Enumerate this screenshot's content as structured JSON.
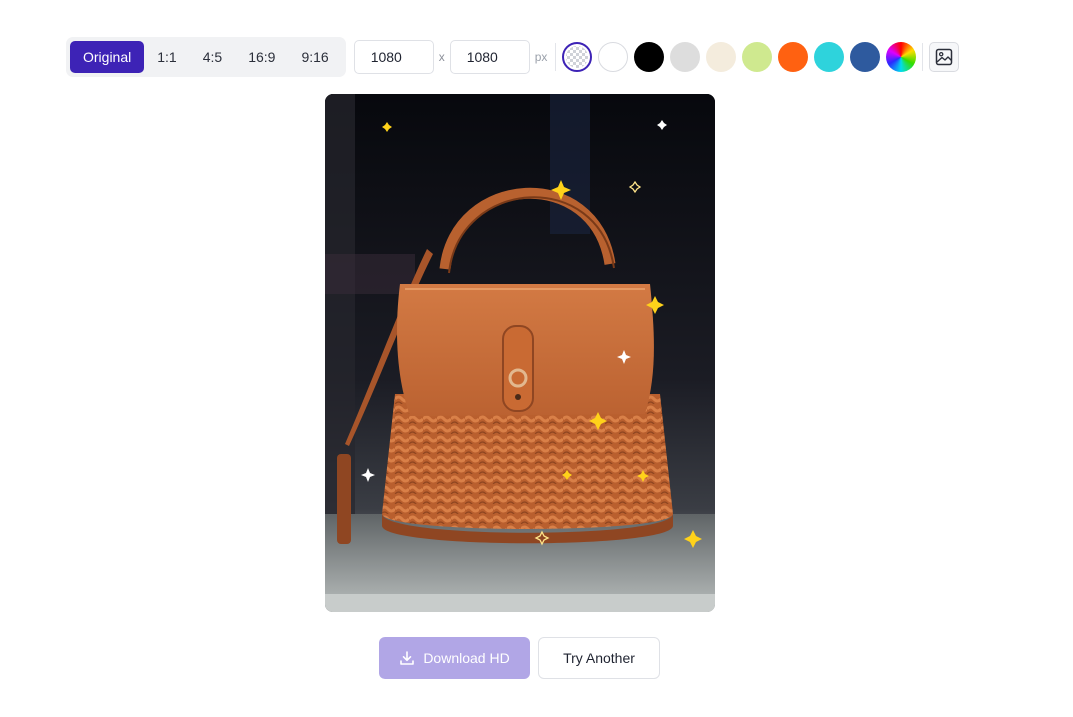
{
  "toolbar": {
    "ratios": [
      {
        "label": "Original",
        "active": true
      },
      {
        "label": "1:1",
        "active": false
      },
      {
        "label": "4:5",
        "active": false
      },
      {
        "label": "16:9",
        "active": false
      },
      {
        "label": "9:16",
        "active": false
      }
    ],
    "width_value": "1080",
    "height_value": "1080",
    "separator": "x",
    "unit": "px",
    "swatches": [
      {
        "name": "transparent",
        "color": "transparent",
        "selected": true
      },
      {
        "name": "white",
        "color": "#ffffff"
      },
      {
        "name": "black",
        "color": "#000000"
      },
      {
        "name": "light-gray",
        "color": "#dddddd"
      },
      {
        "name": "cream",
        "color": "#f4ecdd"
      },
      {
        "name": "lime",
        "color": "#cfe98f"
      },
      {
        "name": "orange",
        "color": "#ff6111"
      },
      {
        "name": "cyan",
        "color": "#2ed3dc"
      },
      {
        "name": "blue",
        "color": "#2e5a9e"
      },
      {
        "name": "custom-rainbow",
        "color": "rainbow"
      }
    ],
    "upload_icon": "image-icon"
  },
  "preview": {
    "subject": "wicker handbag with orange leather flap",
    "accent": "#c96a33"
  },
  "actions": {
    "download_label": "Download HD",
    "download_icon": "download-icon",
    "try_another_label": "Try Another"
  }
}
